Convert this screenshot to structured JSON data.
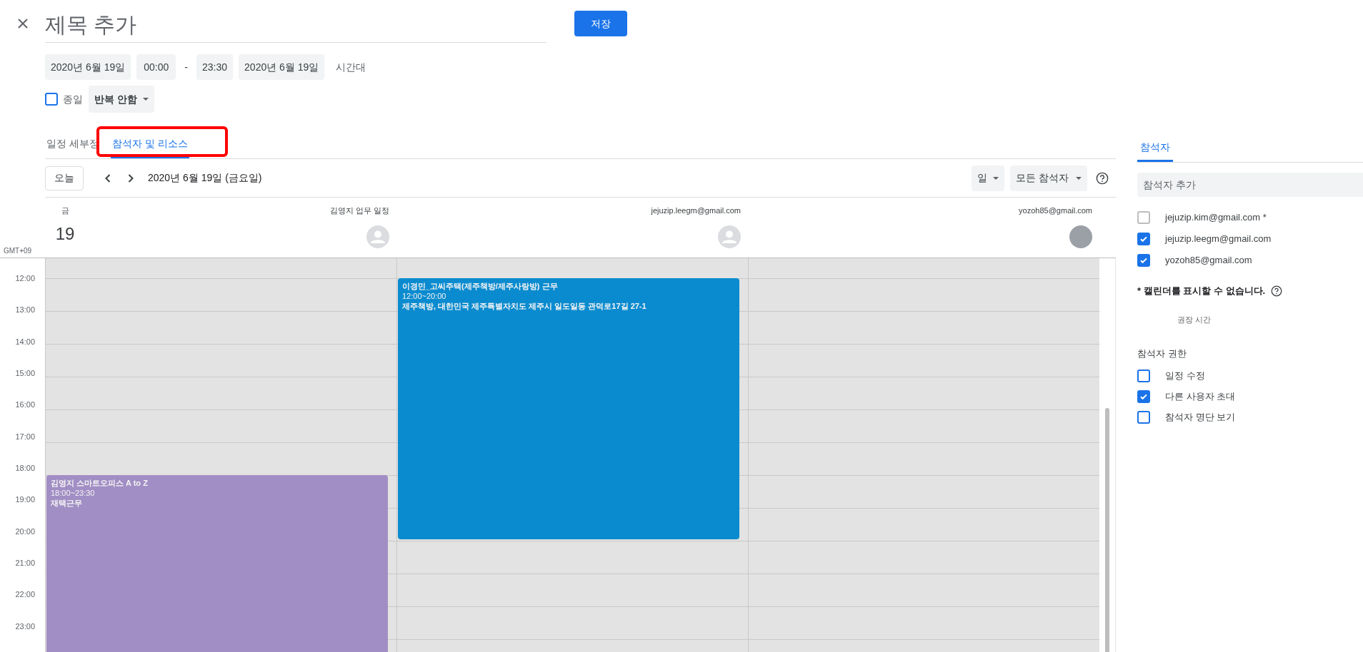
{
  "header": {
    "title_placeholder": "제목 추가",
    "save": "저장"
  },
  "datetime": {
    "start_date": "2020년 6월 19일",
    "start_time": "00:00",
    "separator": "-",
    "end_time": "23:30",
    "end_date": "2020년 6월 19일",
    "timezone": "시간대"
  },
  "all_day": {
    "label": "종일",
    "checked": false
  },
  "repeat": {
    "value": "반복 안함"
  },
  "tabs": [
    {
      "label": "일정 세부정",
      "selected": false
    },
    {
      "label": "참석자 및 리소스",
      "selected": true
    }
  ],
  "annotation": {
    "color": "#ff0000"
  },
  "toolbar": {
    "today": "오늘",
    "date": "2020년 6월 19일 (금요일)",
    "view": "일",
    "filter": "모든 참석자"
  },
  "day": {
    "weekday": "금",
    "number": "19"
  },
  "timezone_label": "GMT+09",
  "hours": [
    "12:00",
    "13:00",
    "14:00",
    "15:00",
    "16:00",
    "17:00",
    "18:00",
    "19:00",
    "20:00",
    "21:00",
    "22:00",
    "23:00"
  ],
  "columns": [
    {
      "name": "김영지 업무 일정",
      "kind": "generic",
      "events": [
        {
          "title": "김영지 스마트오피스 A to Z",
          "time": "18:00~23:30",
          "detail": "재택근무",
          "color": "#a18ec4"
        }
      ]
    },
    {
      "name": "jejuzip.leegm@gmail.com",
      "kind": "generic",
      "events": [
        {
          "title": "이경민_고씨주택(제주책방/제주사랑방) 근무",
          "time": "12:00~20:00",
          "detail": "제주책방, 대한민국 제주특별자치도 제주시 일도일동 관덕로17길 27-1",
          "color": "#0b8bcf"
        }
      ]
    },
    {
      "name": "yozoh85@gmail.com",
      "kind": "photo"
    }
  ],
  "side": {
    "tab": {
      "label": "참석자",
      "selected": true
    },
    "add_placeholder": "참석자 추가",
    "attendees": [
      {
        "email": "jejuzip.kim@gmail.com *",
        "checked": false,
        "disabled": true
      },
      {
        "email": "jejuzip.leegm@gmail.com",
        "checked": true,
        "disabled": false
      },
      {
        "email": "yozoh85@gmail.com",
        "checked": true,
        "disabled": false
      }
    ],
    "note": "* 캘린더를 표시할 수 없습니다.",
    "suggested": "권장 시간",
    "permissions_title": "참석자 권한",
    "permissions": [
      {
        "label": "일정 수정",
        "checked": false
      },
      {
        "label": "다른 사용자 초대",
        "checked": true
      },
      {
        "label": "참석자 명단 보기",
        "checked": false
      }
    ]
  }
}
